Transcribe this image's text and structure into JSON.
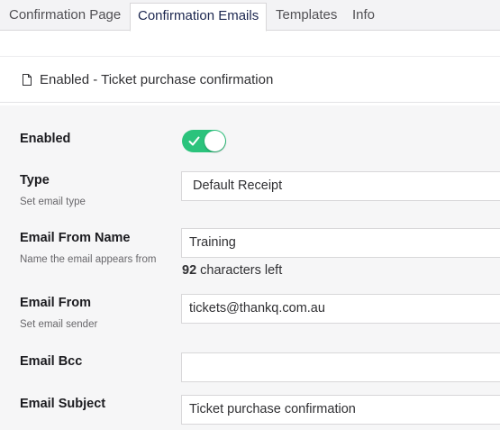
{
  "tabs": [
    {
      "label": "Confirmation Page",
      "active": false
    },
    {
      "label": "Confirmation Emails",
      "active": true
    },
    {
      "label": "Templates",
      "active": false
    },
    {
      "label": "Info",
      "active": false
    }
  ],
  "header": {
    "icon": "document-icon",
    "title": "Enabled - Ticket purchase confirmation"
  },
  "form": {
    "enabled": {
      "label": "Enabled",
      "value": true
    },
    "type": {
      "label": "Type",
      "description": "Set email type",
      "value": "Default Receipt"
    },
    "from_name": {
      "label": "Email From Name",
      "description": "Name the email appears from",
      "value": "Training",
      "chars_left_count": "92",
      "chars_left_text": "characters left"
    },
    "from": {
      "label": "Email From",
      "description": "Set email sender",
      "value": "tickets@thankq.com.au"
    },
    "bcc": {
      "label": "Email Bcc",
      "value": ""
    },
    "subject": {
      "label": "Email Subject",
      "value": "Ticket purchase confirmation"
    }
  },
  "colors": {
    "toggle_on": "#2bc37c",
    "tab_bar_bg": "#f3f3f5",
    "form_bg": "#f6f6f7",
    "active_tab_text": "#1b264f"
  }
}
